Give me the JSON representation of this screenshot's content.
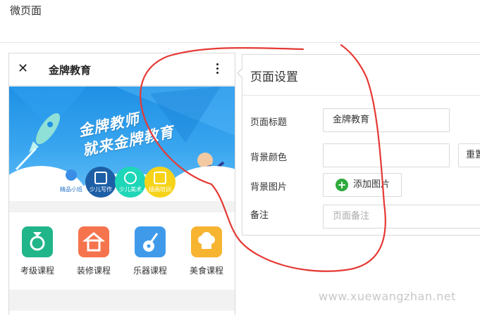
{
  "page": {
    "title": "微页面"
  },
  "phone": {
    "title": "金牌教育",
    "banner": {
      "line1": "金牌教师",
      "line2": "就来金牌教育",
      "badges": [
        "精品小班",
        "少儿写作",
        "少儿美术",
        "插画培训"
      ]
    },
    "categories": [
      {
        "label": "考级课程",
        "icon": "medal-icon",
        "color": "#21b58a"
      },
      {
        "label": "装修课程",
        "icon": "house-icon",
        "color": "#f5744e"
      },
      {
        "label": "乐器课程",
        "icon": "guitar-icon",
        "color": "#3f9bea"
      },
      {
        "label": "美食课程",
        "icon": "chef-hat-icon",
        "color": "#f7b431"
      }
    ]
  },
  "settings": {
    "title": "页面设置",
    "page_title_label": "页面标题",
    "page_title_value": "金牌教育",
    "bg_color_label": "背景颜色",
    "bg_color_value": "",
    "reset_label": "重置",
    "bg_image_label": "背景图片",
    "add_image_label": "添加图片",
    "note_label": "备注",
    "note_placeholder": "页面备注"
  },
  "watermark": "www.xuewangzhan.net",
  "colors": {
    "annotation": "#e53935",
    "add_icon": "#2eaa3c",
    "banner": "#1e90e4"
  }
}
